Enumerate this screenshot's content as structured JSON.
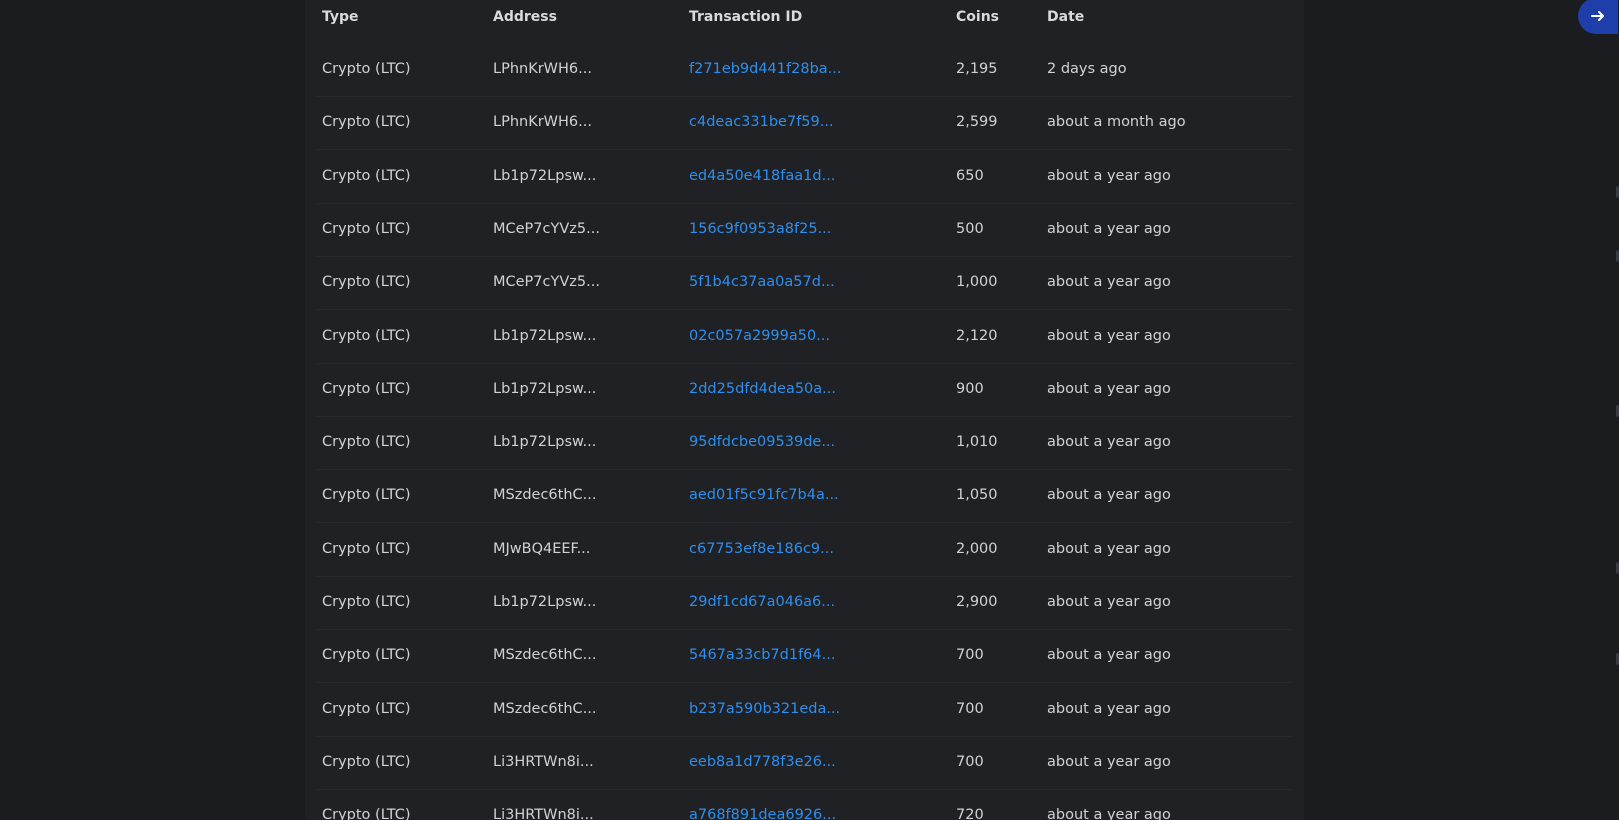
{
  "table": {
    "headers": {
      "type": "Type",
      "address": "Address",
      "transaction_id": "Transaction ID",
      "coins": "Coins",
      "date": "Date"
    },
    "rows": [
      {
        "type": "Crypto (LTC)",
        "address": "LPhnKrWH6...",
        "transaction_id": "f271eb9d441f28ba...",
        "coins": "2,195",
        "date": "2 days ago"
      },
      {
        "type": "Crypto (LTC)",
        "address": "LPhnKrWH6...",
        "transaction_id": "c4deac331be7f59...",
        "coins": "2,599",
        "date": "about a month ago"
      },
      {
        "type": "Crypto (LTC)",
        "address": "Lb1p72Lpsw...",
        "transaction_id": "ed4a50e418faa1d...",
        "coins": "650",
        "date": "about a year ago"
      },
      {
        "type": "Crypto (LTC)",
        "address": "MCeP7cYVz5...",
        "transaction_id": "156c9f0953a8f25...",
        "coins": "500",
        "date": "about a year ago"
      },
      {
        "type": "Crypto (LTC)",
        "address": "MCeP7cYVz5...",
        "transaction_id": "5f1b4c37aa0a57d...",
        "coins": "1,000",
        "date": "about a year ago"
      },
      {
        "type": "Crypto (LTC)",
        "address": "Lb1p72Lpsw...",
        "transaction_id": "02c057a2999a50...",
        "coins": "2,120",
        "date": "about a year ago"
      },
      {
        "type": "Crypto (LTC)",
        "address": "Lb1p72Lpsw...",
        "transaction_id": "2dd25dfd4dea50a...",
        "coins": "900",
        "date": "about a year ago"
      },
      {
        "type": "Crypto (LTC)",
        "address": "Lb1p72Lpsw...",
        "transaction_id": "95dfdcbe09539de...",
        "coins": "1,010",
        "date": "about a year ago"
      },
      {
        "type": "Crypto (LTC)",
        "address": "MSzdec6thC...",
        "transaction_id": "aed01f5c91fc7b4a...",
        "coins": "1,050",
        "date": "about a year ago"
      },
      {
        "type": "Crypto (LTC)",
        "address": "MJwBQ4EEF...",
        "transaction_id": "c67753ef8e186c9...",
        "coins": "2,000",
        "date": "about a year ago"
      },
      {
        "type": "Crypto (LTC)",
        "address": "Lb1p72Lpsw...",
        "transaction_id": "29df1cd67a046a6...",
        "coins": "2,900",
        "date": "about a year ago"
      },
      {
        "type": "Crypto (LTC)",
        "address": "MSzdec6thC...",
        "transaction_id": "5467a33cb7d1f64...",
        "coins": "700",
        "date": "about a year ago"
      },
      {
        "type": "Crypto (LTC)",
        "address": "MSzdec6thC...",
        "transaction_id": "b237a590b321eda...",
        "coins": "700",
        "date": "about a year ago"
      },
      {
        "type": "Crypto (LTC)",
        "address": "Li3HRTWn8i...",
        "transaction_id": "eeb8a1d778f3e26...",
        "coins": "700",
        "date": "about a year ago"
      },
      {
        "type": "Crypto (LTC)",
        "address": "Li3HRTWn8i...",
        "transaction_id": "a768f891dea6926...",
        "coins": "720",
        "date": "about a year ago"
      }
    ]
  },
  "fab": {
    "icon": "arrow-right-icon",
    "color": "#1e3fa9"
  },
  "colors": {
    "background": "#1a1c1f",
    "panel": "#1f2124",
    "link": "#2d8ff0",
    "text": "#d0d2d5"
  }
}
